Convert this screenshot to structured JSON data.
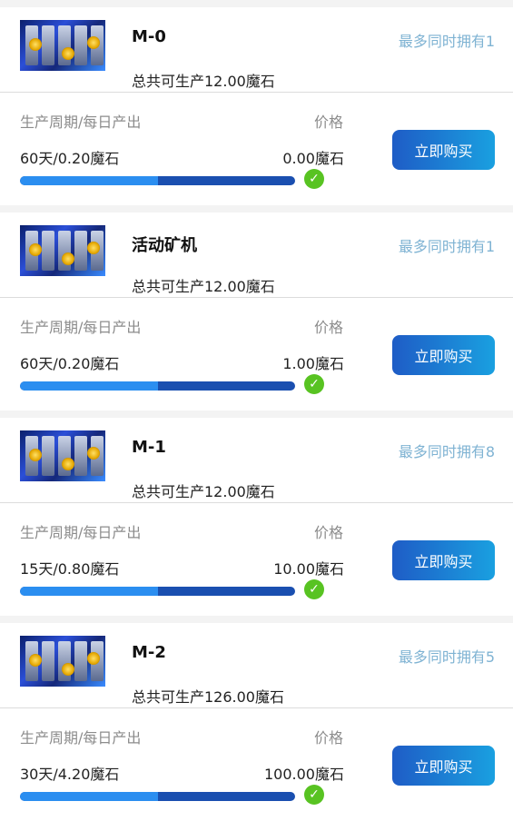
{
  "icons": {
    "thumbnail": "mining-rig-image",
    "check": "check-icon"
  },
  "colors": {
    "accent": "#1e5cc6",
    "limit_text": "#7fb3d3",
    "check": "#58c322"
  },
  "products": [
    {
      "name": "M-0",
      "limit": "最多同时拥有1",
      "total": "总共可生产12.00魔石",
      "period_label": "生产周期/每日产出",
      "price_label": "价格",
      "period_value": "60天/0.20魔石",
      "price_value": "0.00魔石",
      "progress": 0.5,
      "buy_label": "立即购买"
    },
    {
      "name": "活动矿机",
      "limit": "最多同时拥有1",
      "total": "总共可生产12.00魔石",
      "period_label": "生产周期/每日产出",
      "price_label": "价格",
      "period_value": "60天/0.20魔石",
      "price_value": "1.00魔石",
      "progress": 0.5,
      "buy_label": "立即购买"
    },
    {
      "name": "M-1",
      "limit": "最多同时拥有8",
      "total": "总共可生产12.00魔石",
      "period_label": "生产周期/每日产出",
      "price_label": "价格",
      "period_value": "15天/0.80魔石",
      "price_value": "10.00魔石",
      "progress": 0.5,
      "buy_label": "立即购买"
    },
    {
      "name": "M-2",
      "limit": "最多同时拥有5",
      "total": "总共可生产126.00魔石",
      "period_label": "生产周期/每日产出",
      "price_label": "价格",
      "period_value": "30天/4.20魔石",
      "price_value": "100.00魔石",
      "progress": 0.5,
      "buy_label": "立即购买"
    }
  ]
}
